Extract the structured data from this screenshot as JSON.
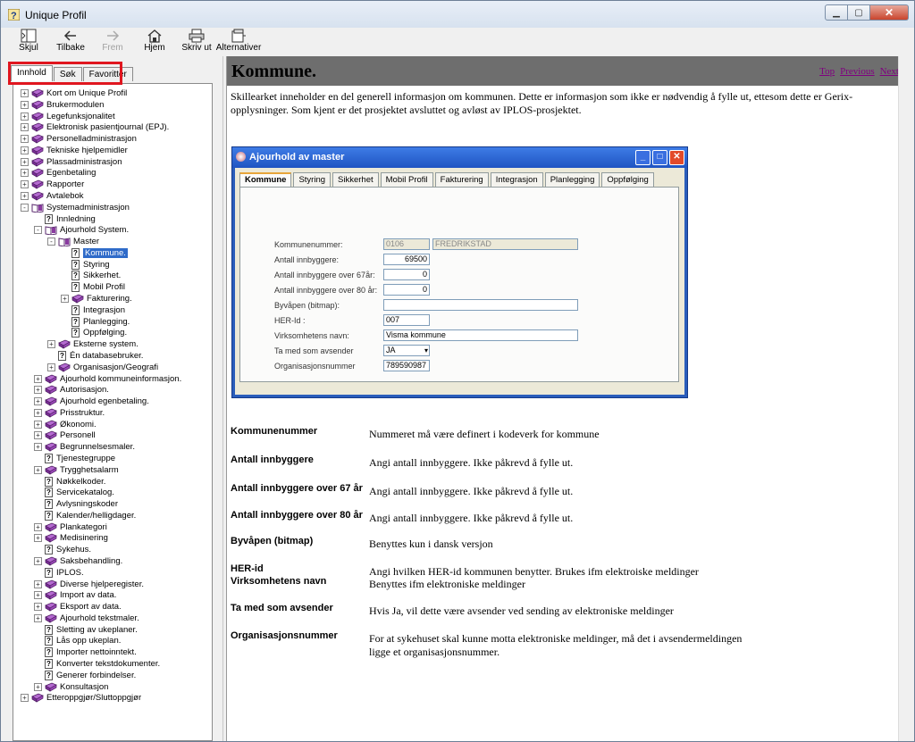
{
  "window": {
    "title": "Unique Profil"
  },
  "toolbar": {
    "buttons": [
      {
        "label": "Skjul",
        "icon": "hide-pane-icon"
      },
      {
        "label": "Tilbake",
        "icon": "back-arrow-icon"
      },
      {
        "label": "Frem",
        "icon": "forward-arrow-icon"
      },
      {
        "label": "Hjem",
        "icon": "home-icon"
      },
      {
        "label": "Skriv ut",
        "icon": "printer-icon"
      },
      {
        "label": "Alternativer",
        "icon": "options-icon"
      }
    ]
  },
  "nav_tabs": [
    "Innhold",
    "Søk",
    "Favoritter"
  ],
  "tree": [
    "Kort om Unique Profil",
    "Brukermodulen",
    "Legefunksjonalitet",
    "Elektronisk pasientjournal (EPJ).",
    "Personelladministrasjon",
    "Tekniske hjelpemidler",
    "Plassadministrasjon",
    "Egenbetaling",
    "Rapporter",
    "Avtalebok",
    "Systemadministrasjon",
    "Innledning",
    "Ajourhold System.",
    "Master",
    "Kommune.",
    "Styring",
    "Sikkerhet.",
    "Mobil Profil",
    "Fakturering.",
    "Integrasjon",
    "Planlegging.",
    "Oppfølging.",
    "Eksterne system.",
    "Én databasebruker.",
    "Organisasjon/Geografi",
    "Ajourhold kommuneinformasjon.",
    "Autorisasjon.",
    "Ajourhold egenbetaling.",
    "Prisstruktur.",
    "Økonomi.",
    "Personell",
    "Begrunnelsesmaler.",
    "Tjenestegruppe",
    "Trygghetsalarm",
    "Nøkkelkoder.",
    "Servicekatalog.",
    "Avlysningskoder",
    "Kalender/helligdager.",
    "Plankategori",
    "Medisinering",
    "Sykehus.",
    "Saksbehandling.",
    "IPLOS.",
    "Diverse hjelperegister.",
    "Import av data.",
    "Eksport av data.",
    "Ajourhold tekstmaler.",
    "Sletting av ukeplaner.",
    "Lås opp ukeplan.",
    "Importer nettoinntekt.",
    "Konverter tekstdokumenter.",
    "Generer forbindelser.",
    "Konsultasjon",
    "Etteroppgjør/Sluttoppgjør"
  ],
  "content": {
    "title": "Kommune.",
    "links": [
      "Top",
      "Previous",
      "Next"
    ],
    "intro": "Skillearket inneholder en del generell informasjon om kommunen. Dette er informasjon som ikke er nødvendig å fylle ut, ettesom dette er Gerix-opplysninger. Som kjent er det prosjektet avsluttet og avløst av IPLOS-prosjektet."
  },
  "dialog": {
    "title": "Ajourhold av master",
    "tabs": [
      "Kommune",
      "Styring",
      "Sikkerhet",
      "Mobil Profil",
      "Fakturering",
      "Integrasjon",
      "Planlegging",
      "Oppfølging"
    ],
    "fields": {
      "kommunenummer_label": "Kommunenummer:",
      "kommunenummer": "0106",
      "kommunenavn": "FREDRIKSTAD",
      "innbyggere_label": "Antall innbyggere:",
      "innbyggere": "69500",
      "over67_label": "Antall innbyggere over 67år:",
      "over67": "0",
      "over80_label": "Antall innbyggere over 80 år:",
      "over80": "0",
      "byvapen_label": "Byvåpen (bitmap):",
      "byvapen": "",
      "herid_label": "HER-Id :",
      "herid": "007",
      "virksomhet_label": "Virksomhetens navn:",
      "virksomhet": "Visma kommune",
      "avsender_label": "Ta med som avsender",
      "avsender": "JA",
      "orgnr_label": "Organisasjonsnummer",
      "orgnr": "789590987"
    }
  },
  "descriptions": [
    {
      "term": "Kommunenummer",
      "def": "Nummeret må være definert i kodeverk for kommune"
    },
    {
      "term": "Antall innbyggere",
      "def": "Angi antall innbyggere. Ikke påkrevd å fylle ut."
    },
    {
      "term": "Antall innbyggere over 67 år",
      "def": "Angi antall innbyggere. Ikke påkrevd å fylle ut."
    },
    {
      "term": "Antall innbyggere over 80 år",
      "def": "Angi antall innbyggere. Ikke påkrevd å fylle ut."
    },
    {
      "term": "Byvåpen (bitmap)",
      "def": "Benyttes kun i dansk versjon"
    },
    {
      "term": "HER-id",
      "def": "Angi hvilken HER-id kommunen benytter. Brukes ifm elektroiske meldinger"
    },
    {
      "term": "Virksomhetens navn",
      "def": "Benyttes ifm elektroniske meldinger"
    },
    {
      "term": "Ta med som avsender",
      "def": "Hvis Ja, vil dette være avsender ved sending av elektroniske meldinger"
    },
    {
      "term": "Organisasjonsnummer",
      "def": "For at sykehuset skal kunne motta elektroniske meldinger, må det i avsendermeldingen ligge et organisasjonsnummer."
    }
  ]
}
